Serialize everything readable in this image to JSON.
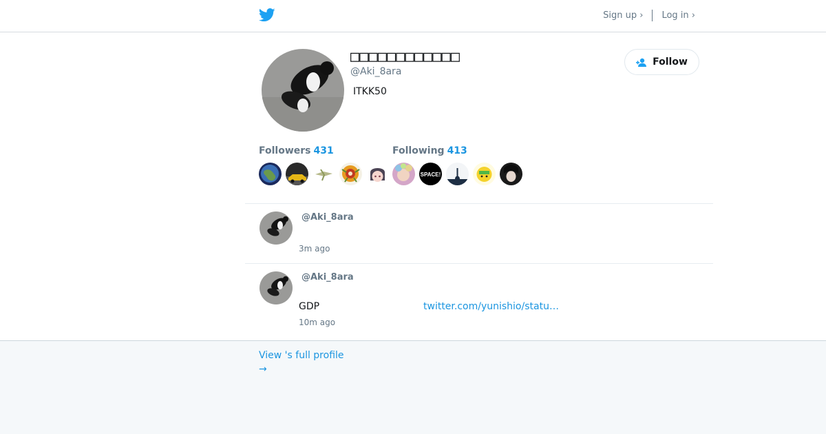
{
  "header": {
    "logo_icon": "twitter-bird-icon",
    "signup_label": "Sign up ›",
    "login_label": "Log in ›"
  },
  "profile": {
    "display_name": "□□□□□□□□□□□□",
    "handle": "@Aki_8ara",
    "bio": "ITKK50",
    "follow_label": "Follow"
  },
  "stats": {
    "followers_label": "Followers",
    "followers_count": "431",
    "following_label": "Following",
    "following_count": "413"
  },
  "tweets": [
    {
      "handle": "@Aki_8ara",
      "text": "",
      "link": "",
      "time": "3m ago"
    },
    {
      "handle": "@Aki_8ara",
      "text": "GDP",
      "link": "twitter.com/yunishio/statu…",
      "time": "10m ago"
    }
  ],
  "footer": {
    "full_profile_label": "View 's full profile",
    "arrow": "→"
  },
  "colors": {
    "accent": "#1b95e0",
    "muted": "#657786",
    "footer_bg": "#f5f8fa"
  }
}
